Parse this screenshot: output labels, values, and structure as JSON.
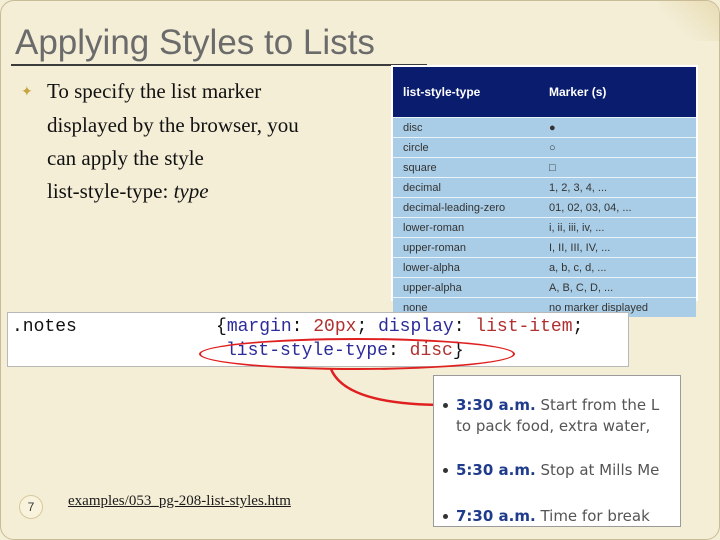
{
  "slide": {
    "title": "Applying Styles to Lists",
    "bullet": {
      "line1": "To specify the list marker",
      "line2": "displayed by the browser, you",
      "line3": "can apply the style",
      "line4_prefix": "list-style-type: ",
      "line4_italic": "type"
    },
    "page_number": "7",
    "link_text": "examples/053_pg-208-list-styles.htm"
  },
  "table": {
    "headers": [
      "list-style-type",
      "Marker (s)"
    ],
    "rows": [
      {
        "type": "disc",
        "marker": "●"
      },
      {
        "type": "circle",
        "marker": "○"
      },
      {
        "type": "square",
        "marker": "□"
      },
      {
        "type": "decimal",
        "marker": "1, 2, 3, 4, ..."
      },
      {
        "type": "decimal-leading-zero",
        "marker": "01, 02, 03, 04, ..."
      },
      {
        "type": "lower-roman",
        "marker": "i, ii, iii, iv, ..."
      },
      {
        "type": "upper-roman",
        "marker": "I, II, III, IV, ..."
      },
      {
        "type": "lower-alpha",
        "marker": "a, b, c, d, ..."
      },
      {
        "type": "upper-alpha",
        "marker": "A, B, C, D, ..."
      },
      {
        "type": "none",
        "marker": "no marker displayed"
      }
    ]
  },
  "code": {
    "selector": ".notes",
    "line1_open": "{",
    "line1_p1": "margin",
    "line1_c1": ": ",
    "line1_v1": "20px",
    "line1_s1": "; ",
    "line1_p2": "display",
    "line1_c2": ": ",
    "line1_v2": "list-item",
    "line1_s2": ";",
    "line2_p": "list-style-type",
    "line2_c": ": ",
    "line2_v": "disc",
    "line2_close": "}"
  },
  "preview": {
    "items": [
      {
        "time": "3:30 a.m.",
        "text": " Start from the L",
        "cont": "to pack food, extra water,"
      },
      {
        "time": "5:30 a.m.",
        "text": " Stop at Mills Me",
        "cont": ""
      },
      {
        "time": "7:30 a.m.",
        "text": " Time for break",
        "cont": ""
      }
    ]
  },
  "colors": {
    "background": "#f4eed7",
    "table_header": "#0a1c6e",
    "table_row": "#a9cde6",
    "highlight_oval": "#e02020",
    "bullet": "#c7a43d"
  }
}
